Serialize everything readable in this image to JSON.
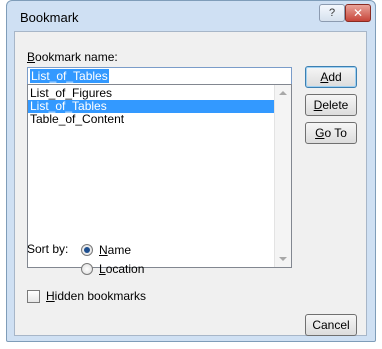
{
  "window": {
    "title": "Bookmark",
    "help_glyph": "?",
    "close_glyph": "✕"
  },
  "bookmark_name": {
    "label_prefix": "",
    "label_underline": "B",
    "label_rest": "ookmark name:",
    "value": "List_of_Tables"
  },
  "bookmarks": [
    {
      "name": "List_of_Figures",
      "selected": false
    },
    {
      "name": "List_of_Tables",
      "selected": true
    },
    {
      "name": "Table_of_Content",
      "selected": false
    }
  ],
  "buttons": {
    "add": {
      "u": "A",
      "rest": "dd"
    },
    "delete": {
      "u": "D",
      "rest": "elete"
    },
    "goto": {
      "u": "G",
      "rest": "o To"
    },
    "cancel": "Cancel"
  },
  "sort": {
    "label": "Sort by:",
    "name": {
      "u": "N",
      "rest": "ame",
      "checked": true
    },
    "location": {
      "u": "L",
      "rest": "ocation",
      "checked": false
    }
  },
  "hidden": {
    "u": "H",
    "rest": "idden bookmarks",
    "checked": false
  }
}
